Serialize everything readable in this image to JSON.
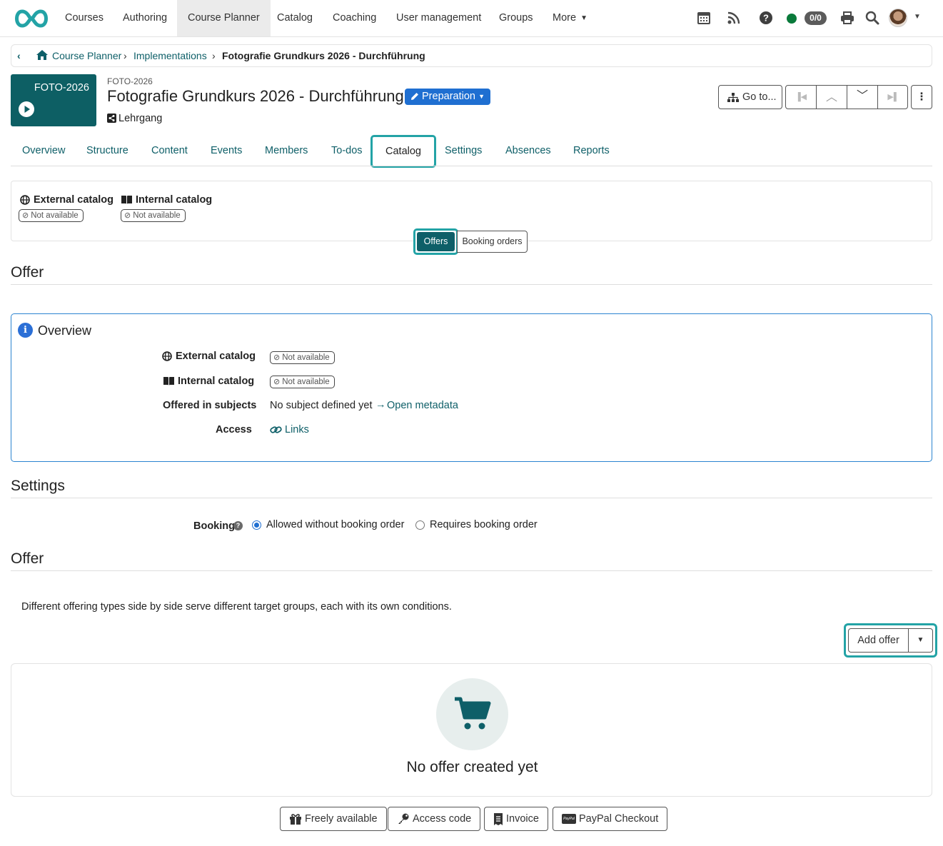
{
  "nav": {
    "items": [
      "Courses",
      "Authoring",
      "Course Planner",
      "Catalog",
      "Coaching",
      "User management",
      "Groups",
      "More"
    ],
    "active": "Course Planner",
    "counter": "0/0"
  },
  "breadcrumb": {
    "items": [
      "Course Planner",
      "Implementations"
    ],
    "current": "Fotografie Grundkurs 2026 - Durchführung"
  },
  "header": {
    "thumb_label": "FOTO-2026",
    "ref": "FOTO-2026",
    "title": "Fotografie Grundkurs 2026 - Durchführung",
    "status": "Preparation",
    "type": "Lehrgang",
    "goto_label": "Go to..."
  },
  "tabs": [
    "Overview",
    "Structure",
    "Content",
    "Events",
    "Members",
    "To-dos",
    "Catalog",
    "Settings",
    "Absences",
    "Reports"
  ],
  "active_tab": "Catalog",
  "catalog_summary": {
    "external_label": "External catalog",
    "external_status": "Not available",
    "internal_label": "Internal catalog",
    "internal_status": "Not available",
    "toggle_offers": "Offers",
    "toggle_booking": "Booking orders"
  },
  "offer_section_title": "Offer",
  "overview": {
    "title": "Overview",
    "rows": {
      "external_label": "External catalog",
      "external_value": "Not available",
      "internal_label": "Internal catalog",
      "internal_value": "Not available",
      "subjects_label": "Offered in subjects",
      "subjects_value": "No subject defined yet",
      "subjects_link": "Open metadata",
      "access_label": "Access",
      "access_link": "Links"
    }
  },
  "settings": {
    "title": "Settings",
    "booking_label": "Booking",
    "option_allowed": "Allowed without booking order",
    "option_requires": "Requires booking order",
    "selected": "Allowed without booking order"
  },
  "offer2": {
    "title": "Offer",
    "description": "Different offering types side by side serve different target groups, each with its own conditions.",
    "add_offer": "Add offer",
    "empty_text": "No offer created yet",
    "methods": [
      "Freely available",
      "Access code",
      "Invoice",
      "PayPal Checkout"
    ]
  },
  "colors": {
    "accent": "#0e5f68",
    "highlight": "#23a3a6",
    "status_blue": "#1f6fd1",
    "online": "#0a7a3b"
  }
}
